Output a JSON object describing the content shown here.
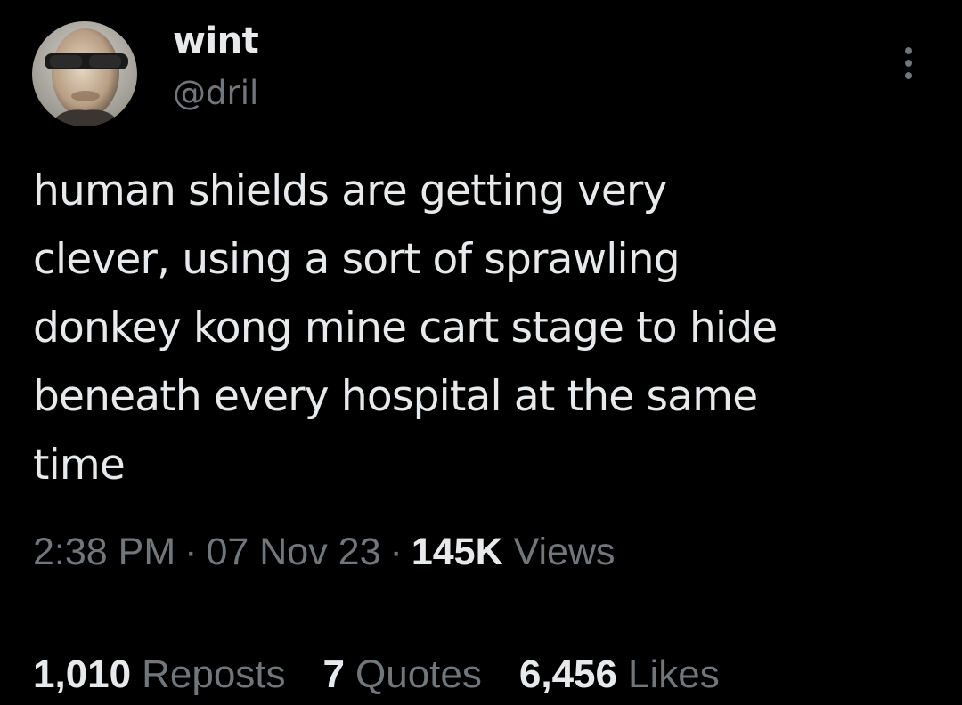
{
  "author": {
    "display_name": "wint",
    "handle": "@dril",
    "avatar_icon": "user-avatar-photo"
  },
  "more_icon": "ellipsis-vertical-icon",
  "tweet": {
    "text": "human shields are getting very\nclever, using a sort of sprawling\ndonkey kong mine cart stage to hide\nbeneath every hospital at the same\ntime"
  },
  "meta": {
    "time": "2:38 PM",
    "separator": "·",
    "date": "07 Nov 23",
    "views_count": "145K",
    "views_label": "Views"
  },
  "stats": {
    "reposts_count": "1,010",
    "reposts_label": "Reposts",
    "quotes_count": "7",
    "quotes_label": "Quotes",
    "likes_count": "6,456",
    "likes_label": "Likes"
  },
  "colors": {
    "background": "#000000",
    "primary_text": "#e7e9ea",
    "secondary_text": "#71767b",
    "divider": "#2f3336"
  }
}
